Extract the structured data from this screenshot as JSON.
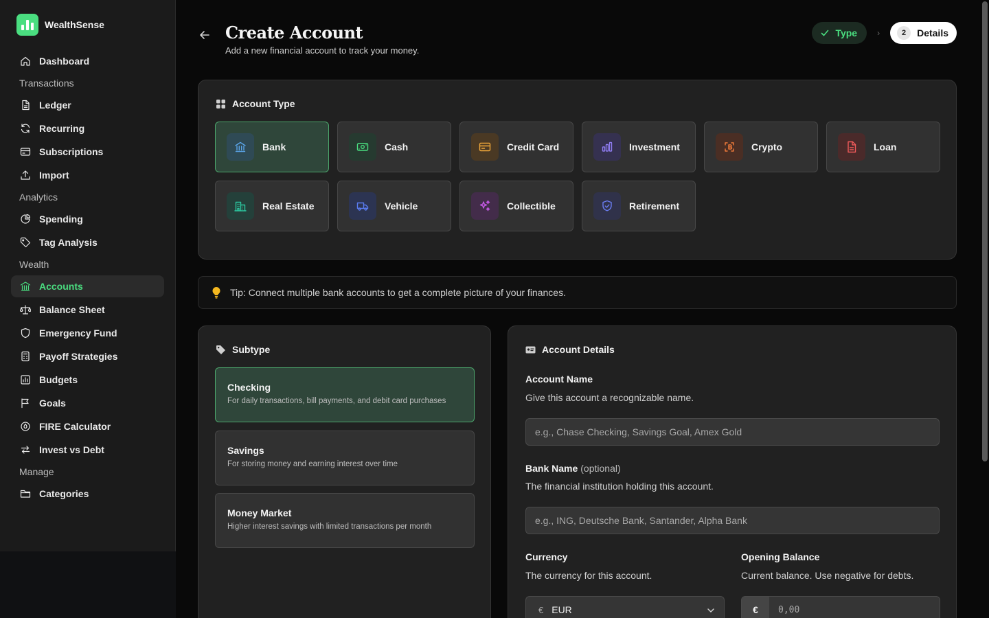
{
  "app": {
    "name": "WealthSense"
  },
  "sidebar": {
    "items": [
      {
        "label": "Dashboard",
        "icon": "home-icon"
      },
      {
        "section": "Transactions"
      },
      {
        "label": "Ledger",
        "icon": "file-icon"
      },
      {
        "label": "Recurring",
        "icon": "refresh-icon"
      },
      {
        "label": "Subscriptions",
        "icon": "card-icon"
      },
      {
        "label": "Import",
        "icon": "upload-icon"
      },
      {
        "section": "Analytics"
      },
      {
        "label": "Spending",
        "icon": "pie-icon"
      },
      {
        "label": "Tag Analysis",
        "icon": "tag-icon"
      },
      {
        "section": "Wealth"
      },
      {
        "label": "Accounts",
        "icon": "bank-icon",
        "active": true
      },
      {
        "label": "Balance Sheet",
        "icon": "scale-icon"
      },
      {
        "label": "Emergency Fund",
        "icon": "shield-icon"
      },
      {
        "label": "Payoff Strategies",
        "icon": "calculator-icon"
      },
      {
        "label": "Budgets",
        "icon": "budget-icon"
      },
      {
        "label": "Goals",
        "icon": "flag-icon"
      },
      {
        "label": "FIRE Calculator",
        "icon": "flame-icon"
      },
      {
        "label": "Invest vs Debt",
        "icon": "arrows-icon"
      },
      {
        "section": "Manage"
      },
      {
        "label": "Categories",
        "icon": "folder-icon"
      }
    ]
  },
  "header": {
    "title": "Create Account",
    "subtitle": "Add a new financial account to track your money.",
    "steps": {
      "done": "Type",
      "current_num": "2",
      "current": "Details"
    }
  },
  "account_type": {
    "title": "Account Type",
    "types": [
      {
        "label": "Bank",
        "icon": "bank-icon",
        "color": "#5aa4e8",
        "bg": "#2f4a55",
        "selected": true
      },
      {
        "label": "Cash",
        "icon": "cash-icon",
        "color": "#4ade80",
        "bg": "#263a30"
      },
      {
        "label": "Credit Card",
        "icon": "credit-card-icon",
        "color": "#f0a83a",
        "bg": "#4a3924"
      },
      {
        "label": "Investment",
        "icon": "bar-chart-icon",
        "color": "#8f7cf0",
        "bg": "#353150"
      },
      {
        "label": "Crypto",
        "icon": "crypto-icon",
        "color": "#f07a3a",
        "bg": "#4a2e24"
      },
      {
        "label": "Loan",
        "icon": "document-icon",
        "color": "#ef5a5a",
        "bg": "#4a2a2a"
      },
      {
        "label": "Real Estate",
        "icon": "building-icon",
        "color": "#2cc7a0",
        "bg": "#24403a"
      },
      {
        "label": "Vehicle",
        "icon": "truck-icon",
        "color": "#5a7cf0",
        "bg": "#2c3452"
      },
      {
        "label": "Collectible",
        "icon": "sparkles-icon",
        "color": "#c75ae8",
        "bg": "#432c4a"
      },
      {
        "label": "Retirement",
        "icon": "shield-check-icon",
        "color": "#6a7cf0",
        "bg": "#30324a"
      }
    ]
  },
  "tip": {
    "text": "Tip: Connect multiple bank accounts to get a complete picture of your finances."
  },
  "subtype": {
    "title": "Subtype",
    "options": [
      {
        "name": "Checking",
        "desc": "For daily transactions, bill payments, and debit card purchases",
        "selected": true
      },
      {
        "name": "Savings",
        "desc": "For storing money and earning interest over time"
      },
      {
        "name": "Money Market",
        "desc": "Higher interest savings with limited transactions per month"
      }
    ]
  },
  "details": {
    "title": "Account Details",
    "account_name": {
      "label": "Account Name",
      "help": "Give this account a recognizable name.",
      "placeholder": "e.g., Chase Checking, Savings Goal, Amex Gold"
    },
    "bank_name": {
      "label": "Bank Name",
      "optional": "(optional)",
      "help": "The financial institution holding this account.",
      "placeholder": "e.g., ING, Deutsche Bank, Santander, Alpha Bank"
    },
    "currency": {
      "label": "Currency",
      "help": "The currency for this account.",
      "symbol": "€",
      "value": "EUR"
    },
    "balance": {
      "label": "Opening Balance",
      "help": "Current balance. Use negative for debts.",
      "prefix": "€",
      "placeholder": "0,00"
    }
  }
}
